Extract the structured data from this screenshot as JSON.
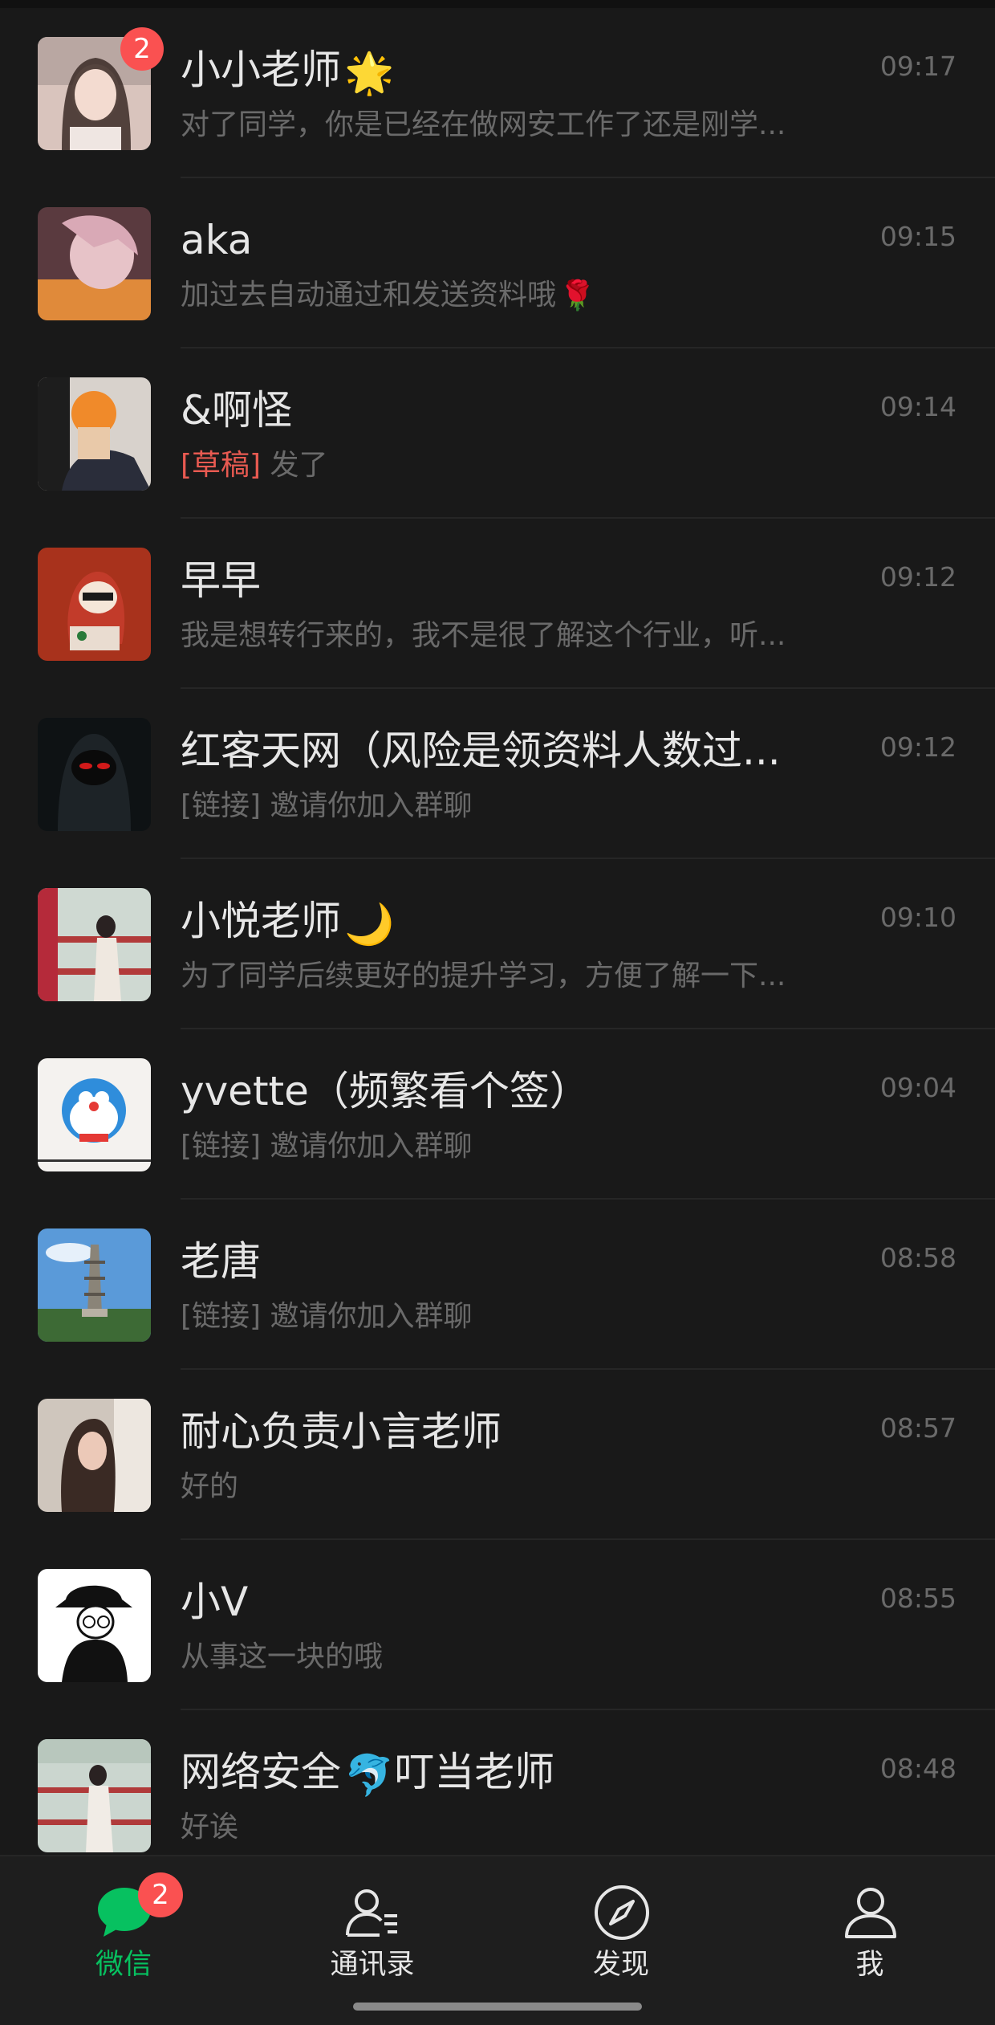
{
  "chats": [
    {
      "name": "小小老师",
      "emoji": "🌟",
      "preview": "对了同学，你是已经在做网安工作了还是刚学...",
      "time": "09:17",
      "badge": "2"
    },
    {
      "name": "aka",
      "preview": "加过去自动通过和发送资料哦",
      "preview_emoji": "🌹",
      "time": "09:15"
    },
    {
      "name": "&啊怪",
      "draft_tag": "[草稿]",
      "preview": " 发了",
      "time": "09:14"
    },
    {
      "name": "早早",
      "preview": "我是想转行来的，我不是很了解这个行业，听...",
      "time": "09:12"
    },
    {
      "name": "红客天网（风险是领资料人数过...",
      "preview": "[链接] 邀请你加入群聊",
      "time": "09:12"
    },
    {
      "name": "小悦老师",
      "emoji": "🌙",
      "preview": "为了同学后续更好的提升学习，方便了解一下...",
      "time": "09:10"
    },
    {
      "name": "yvette（频繁看个签）",
      "preview": "[链接] 邀请你加入群聊",
      "time": "09:04"
    },
    {
      "name": "老唐",
      "preview": "[链接] 邀请你加入群聊",
      "time": "08:58"
    },
    {
      "name": "耐心负责小言老师",
      "preview": "好的",
      "time": "08:57"
    },
    {
      "name": "小V",
      "preview": "从事这一块的哦",
      "time": "08:55"
    },
    {
      "name": "网络安全",
      "emoji": "🐬",
      "name_suffix": "叮当老师",
      "preview": "好诶",
      "time": "08:48"
    }
  ],
  "tabs": [
    {
      "label": "微信",
      "icon": "chat-bubble-icon",
      "active": true,
      "badge": "2"
    },
    {
      "label": "通讯录",
      "icon": "contacts-icon"
    },
    {
      "label": "发现",
      "icon": "compass-icon"
    },
    {
      "label": "我",
      "icon": "person-icon"
    }
  ],
  "colors": {
    "accent": "#07c160",
    "badge": "#fa5151",
    "draft": "#e85a51",
    "background": "#191919"
  }
}
